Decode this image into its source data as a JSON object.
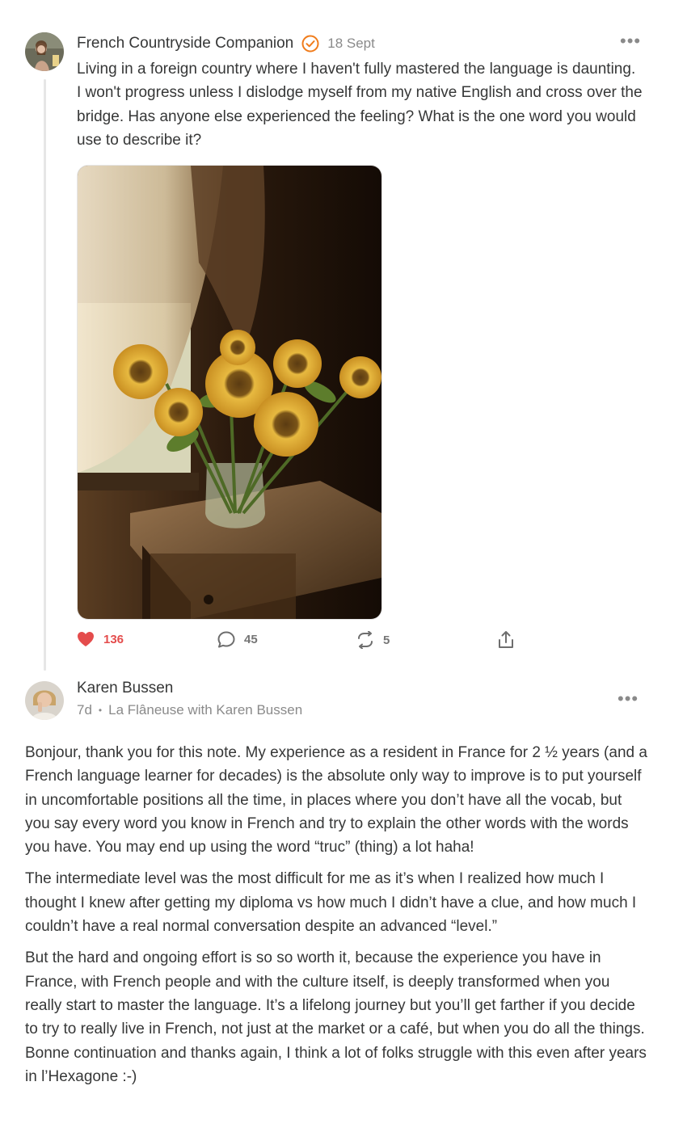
{
  "post": {
    "author": "French Countryside Companion",
    "date": "18 Sept",
    "text": "Living in a foreign country where I haven't fully mastered the language is daunting. I won't progress unless I dislodge myself from my native English and cross over the bridge. Has anyone else experienced the feeling? What is the one word you would use to describe it?",
    "verified_color": "#f07c1b",
    "likes": "136",
    "comments": "45",
    "restacks": "5",
    "like_color": "#e44c4c"
  },
  "reply": {
    "author": "Karen Bussen",
    "age": "7d",
    "publication": "La Flâneuse with Karen Bussen",
    "paragraphs": [
      "Bonjour, thank you for this note. My experience as a resident in France for 2 ½ years (and a French language learner for decades) is the absolute only way to improve is to put yourself in uncomfortable positions all the time, in places where you don’t have all the vocab, but you say every word you know in French and try to explain the other words with the words you have. You may end up using the word “truc” (thing) a lot haha!",
      "The intermediate level was the most difficult for me as it’s when I realized how much I thought I knew after getting my diploma vs how much I didn’t have a clue, and how much I couldn’t have a real normal conversation despite an advanced “level.”",
      "But the hard and ongoing effort is so so worth it, because the experience you have in France, with French people and with the culture itself, is deeply transformed when you really start to master the language. It’s a lifelong journey but you’ll get farther if you decide to try to really live in French, not just at the market or a café, but when you do all the things. Bonne continuation and thanks again, I think a lot of folks struggle with this even after years in l’Hexagone :-)"
    ]
  }
}
